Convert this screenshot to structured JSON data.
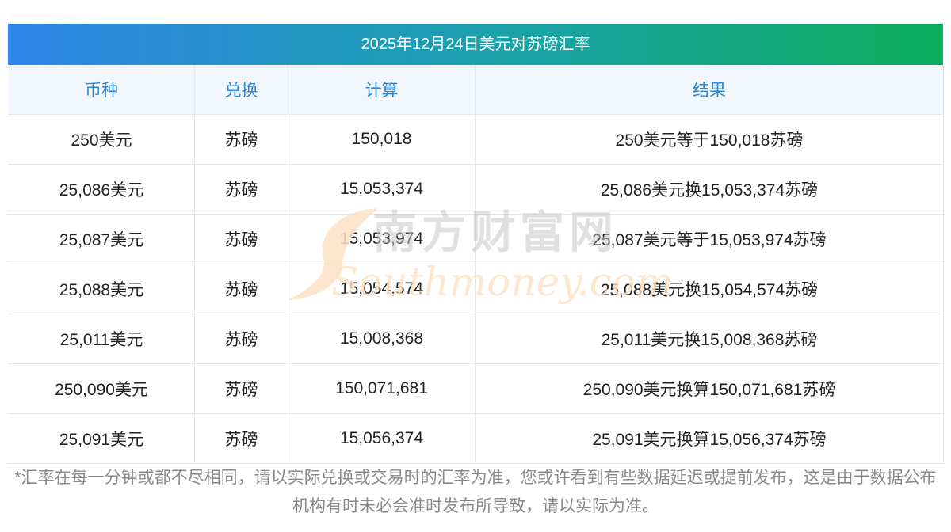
{
  "title": "2025年12月24日美元对苏磅汇率",
  "headers": [
    "币种",
    "兑换",
    "计算",
    "结果"
  ],
  "rows": [
    [
      "250美元",
      "苏磅",
      "150,018",
      "250美元等于150,018苏磅"
    ],
    [
      "25,086美元",
      "苏磅",
      "15,053,374",
      "25,086美元换15,053,374苏磅"
    ],
    [
      "25,087美元",
      "苏磅",
      "15,053,974",
      "25,087美元等于15,053,974苏磅"
    ],
    [
      "25,088美元",
      "苏磅",
      "15,054,574",
      "25,088美元换15,054,574苏磅"
    ],
    [
      "25,011美元",
      "苏磅",
      "15,008,368",
      "25,011美元换15,008,368苏磅"
    ],
    [
      "250,090美元",
      "苏磅",
      "150,071,681",
      "250,090美元换算150,071,681苏磅"
    ],
    [
      "25,091美元",
      "苏磅",
      "15,056,374",
      "25,091美元换算15,056,374苏磅"
    ]
  ],
  "watermark": {
    "cn": "南方财富网",
    "en": "Southmoney.com"
  },
  "note": "*汇率在每一分钟或都不尽相同，请以实际兑换或交易时的汇率为准，您或许看到有些数据延迟或提前发布，这是由于数据公布机构有时未必会准时发布所导致，请以实际为准。",
  "colors": {
    "title_gradient_start": "#2f86e8",
    "title_gradient_end": "#0aae5a",
    "header_text": "#2a86d4",
    "header_bg": "#f1f7fd",
    "note_text": "#8a8a8a"
  }
}
